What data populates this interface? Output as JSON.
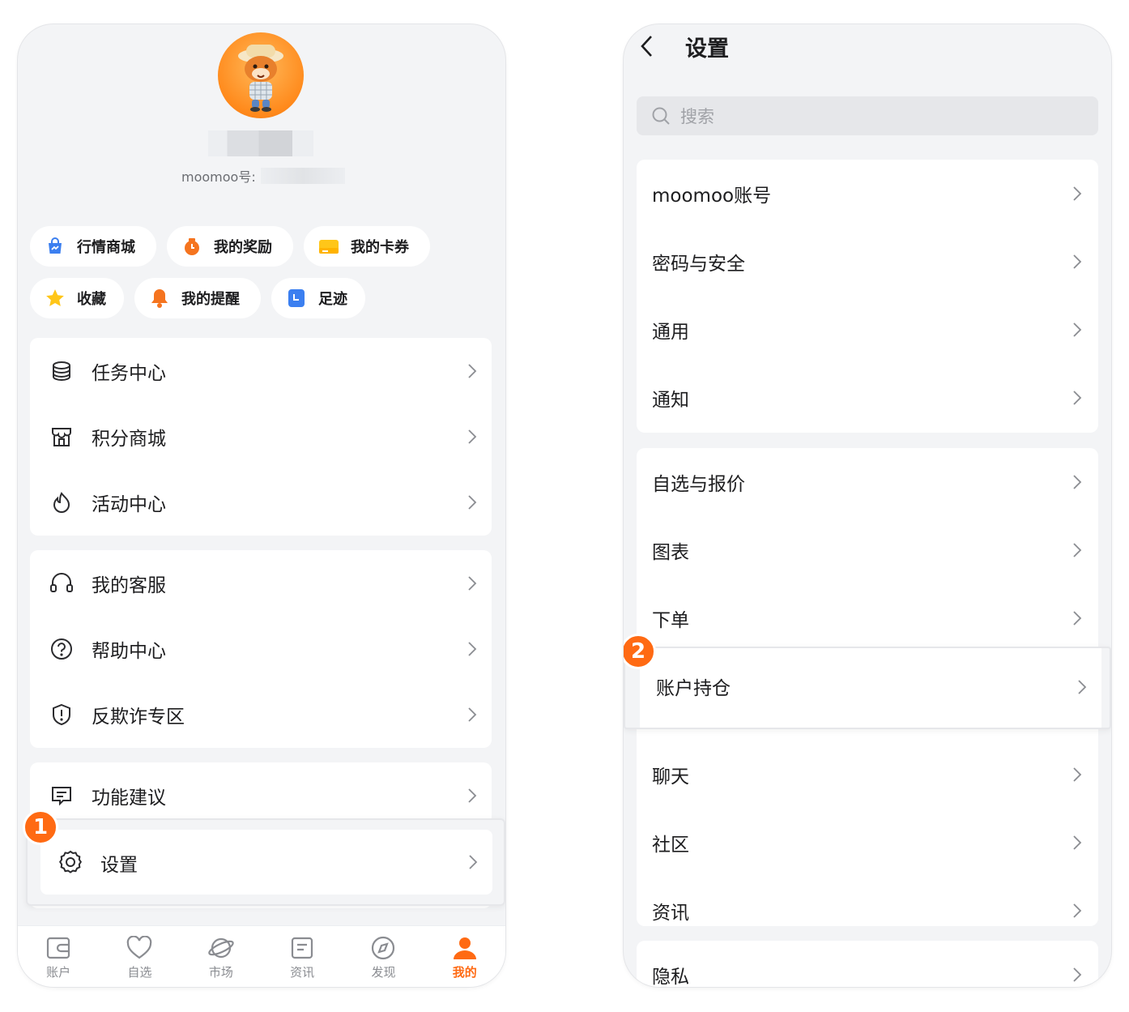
{
  "left": {
    "mm_label": "moomoo号:",
    "chips": [
      {
        "label": "行情商城",
        "icon": "market-bag-icon"
      },
      {
        "label": "我的奖励",
        "icon": "reward-icon"
      },
      {
        "label": "我的卡券",
        "icon": "coupon-icon"
      },
      {
        "label": "收藏",
        "icon": "star-icon"
      },
      {
        "label": "我的提醒",
        "icon": "bell-icon"
      },
      {
        "label": "足迹",
        "icon": "footprint-icon"
      }
    ],
    "group1": [
      "任务中心",
      "积分商城",
      "活动中心"
    ],
    "group2": [
      "我的客服",
      "帮助中心",
      "反欺诈专区"
    ],
    "group3": [
      "功能建议",
      "设置"
    ],
    "badge": "1",
    "tabs": [
      "账户",
      "自选",
      "市场",
      "资讯",
      "发现",
      "我的"
    ],
    "accent": "#ff6a13"
  },
  "right": {
    "title": "设置",
    "search_placeholder": "搜索",
    "group1": [
      "moomoo账号",
      "密码与安全",
      "通用",
      "通知"
    ],
    "group2": [
      "自选与报价",
      "图表",
      "下单",
      "账户持仓",
      "聊天",
      "社区",
      "资讯"
    ],
    "group3": [
      "隐私"
    ],
    "badge": "2"
  }
}
